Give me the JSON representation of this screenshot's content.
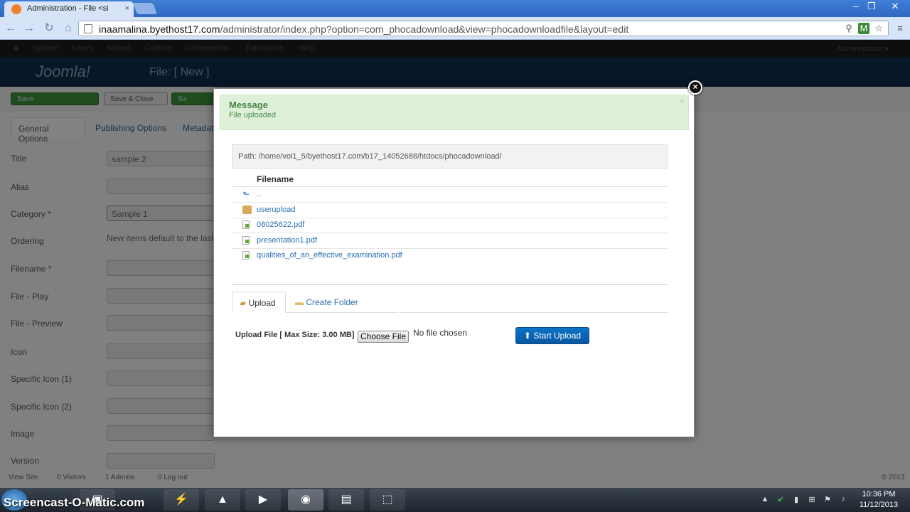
{
  "browser": {
    "tab_title": "Administration - File <si",
    "tab_close": "×",
    "url_domain": "inaamalina.byethost17.com",
    "url_path": "/administrator/index.php?option=com_phocadownload&view=phocadownloadfile&layout=edit",
    "window_minimize": "–",
    "window_restore": "❐",
    "window_close": "✕"
  },
  "joomla": {
    "menu": [
      "System",
      "Users",
      "Menus",
      "Content",
      "Components",
      "Extensions",
      "Help"
    ],
    "user": "Administrator ▾",
    "logo": "Joomla!",
    "page_title": "File: [ New ]",
    "toolbar": {
      "save": "Save",
      "save_close": "Save & Close",
      "save_new": "Sa"
    },
    "tabs": {
      "general": "General Options",
      "publishing": "Publishing Options",
      "metadata": "Metadat"
    },
    "fields": [
      {
        "label": "Title",
        "value": "sample 2"
      },
      {
        "label": "Alias",
        "value": ""
      },
      {
        "label": "Category *",
        "value": "Sample 1"
      },
      {
        "label": "Ordering",
        "value": "New items default to the last"
      },
      {
        "label": "Filename *",
        "value": ""
      },
      {
        "label": "File - Play",
        "value": ""
      },
      {
        "label": "File - Preview",
        "value": ""
      },
      {
        "label": "Icon",
        "value": ""
      },
      {
        "label": "Specific Icon (1)",
        "value": ""
      },
      {
        "label": "Specific Icon (2)",
        "value": ""
      },
      {
        "label": "Image",
        "value": ""
      },
      {
        "label": "Version",
        "value": ""
      }
    ],
    "status": {
      "view_site": "View Site",
      "visitors": "0 Visitors",
      "admins": "1 Admins",
      "logout": "0 Log out",
      "copyright": "© 2013"
    }
  },
  "modal": {
    "message_title": "Message",
    "message_text": "File uploaded",
    "path": "Path: /home/vol1_5/byethost17.com/b17_14052688/htdocs/phocadownload/",
    "filename_header": "Filename",
    "files": [
      {
        "name": "..",
        "icon": "up-icon"
      },
      {
        "name": "userupload",
        "icon": "folder-icon"
      },
      {
        "name": "08025622.pdf",
        "icon": "file-icon"
      },
      {
        "name": "presentation1.pdf",
        "icon": "file-icon"
      },
      {
        "name": "qualities_of_an_effective_examination.pdf",
        "icon": "file-icon"
      }
    ],
    "tab_upload": "Upload",
    "tab_create_folder": "Create Folder",
    "upload_label": "Upload File [ Max Size: 3.00 MB]",
    "choose_file": "Choose File",
    "no_file": "No file chosen",
    "start_upload": "Start Upload"
  },
  "taskbar": {
    "watermark": "Screencast-O-Matic.com",
    "time": "10:36 PM",
    "date": "11/12/2013"
  }
}
